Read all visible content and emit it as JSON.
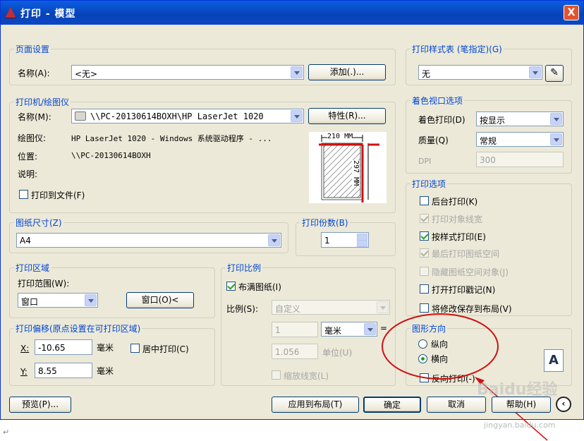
{
  "window": {
    "title": "打印 - 模型",
    "close": "X"
  },
  "page_setup": {
    "group": "页面设置",
    "name_label": "名称(A):",
    "name_value": "<无>",
    "add_button": "添加(.)..."
  },
  "printer": {
    "group": "打印机/绘图仪",
    "name_label": "名称(M):",
    "name_value": "\\\\PC-20130614BOXH\\HP LaserJet 1020",
    "properties_button": "特性(R)...",
    "plotter_label": "绘图仪:",
    "plotter_value": "HP LaserJet 1020 - Windows 系统驱动程序 - ...",
    "location_label": "位置:",
    "location_value": "\\\\PC-20130614BOXH",
    "description_label": "说明:",
    "print_to_file": "打印到文件(F)",
    "print_to_file_checked": false,
    "preview_width": "210 MM",
    "preview_height": "297 MM"
  },
  "paper_size": {
    "group": "图纸尺寸(Z)",
    "value": "A4"
  },
  "copies": {
    "group": "打印份数(B)",
    "value": "1"
  },
  "plot_area": {
    "group": "打印区域",
    "range_label": "打印范围(W):",
    "range_value": "窗口",
    "window_button": "窗口(O)<"
  },
  "plot_offset": {
    "group": "打印偏移(原点设置在可打印区域)",
    "x_label": "X:",
    "x_value": "-10.65",
    "x_unit": "毫米",
    "y_label": "Y:",
    "y_value": "8.55",
    "y_unit": "毫米",
    "center": "居中打印(C)",
    "center_checked": false
  },
  "plot_scale": {
    "group": "打印比例",
    "fit": "布满图纸(I)",
    "fit_checked": true,
    "scale_label": "比例(S):",
    "scale_value": "自定义",
    "value1": "1",
    "unit1": "毫米",
    "equals": "=",
    "value2": "1.056",
    "unit2": "单位(U)",
    "lineweights": "缩放线宽(L)",
    "lineweights_checked": false
  },
  "plot_style": {
    "group": "打印样式表 (笔指定)(G)",
    "value": "无"
  },
  "shaded": {
    "group": "着色视口选项",
    "shade_label": "着色打印(D)",
    "shade_value": "按显示",
    "quality_label": "质量(Q)",
    "quality_value": "常规",
    "dpi_label": "DPI",
    "dpi_value": "300"
  },
  "options": {
    "group": "打印选项",
    "items": [
      {
        "label": "后台打印(K)",
        "checked": false,
        "enabled": true
      },
      {
        "label": "打印对象线宽",
        "checked": true,
        "enabled": false
      },
      {
        "label": "按样式打印(E)",
        "checked": true,
        "enabled": true
      },
      {
        "label": "最后打印图纸空间",
        "checked": true,
        "enabled": false
      },
      {
        "label": "隐藏图纸空间对象(J)",
        "checked": false,
        "enabled": false
      },
      {
        "label": "打开打印戳记(N)",
        "checked": false,
        "enabled": true
      },
      {
        "label": "将修改保存到布局(V)",
        "checked": false,
        "enabled": true
      }
    ]
  },
  "orientation": {
    "group": "图形方向",
    "portrait": "纵向",
    "landscape": "横向",
    "selected": "landscape",
    "upside_down": "反向打印(-)",
    "upside_down_checked": false,
    "icon_letter": "A"
  },
  "footer": {
    "preview": "预览(P)...",
    "apply": "应用到布局(T)",
    "ok": "确定",
    "cancel": "取消",
    "help": "帮助(H)"
  },
  "watermark": {
    "logo": "Baidu经验",
    "url": "jingyan.baidu.com"
  }
}
